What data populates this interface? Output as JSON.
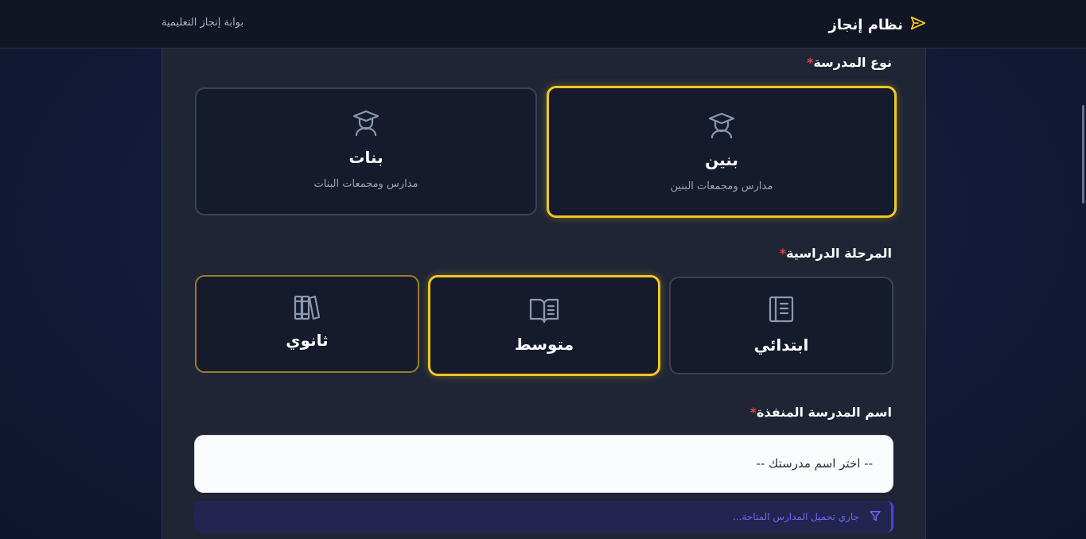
{
  "header": {
    "brand_title": "نظام إنجاز",
    "portal_name": "بوابة إنجاز التعليمية",
    "brand_color": "#f3c622"
  },
  "school_type": {
    "label": "نوع المدرسة",
    "required_mark": "*",
    "options": [
      {
        "title": "بنين",
        "subtitle": "مدارس ومجمعات البنين",
        "icon": "graduate-icon",
        "selected": true
      },
      {
        "title": "بنات",
        "subtitle": "مدارس ومجمعات البنات",
        "icon": "graduate-icon",
        "selected": false
      }
    ]
  },
  "stage": {
    "label": "المرحلة الدراسية",
    "required_mark": "*",
    "options": [
      {
        "title": "ابتدائي",
        "icon": "notebook-icon",
        "selected": false
      },
      {
        "title": "متوسط",
        "icon": "open-book-icon",
        "selected": true
      },
      {
        "title": "ثانوي",
        "icon": "books-icon",
        "selected": false
      }
    ]
  },
  "school_name": {
    "label": "اسم المدرسة المنفذة",
    "required_mark": "*",
    "placeholder": "-- اختر اسم مدرستك --"
  },
  "loading": {
    "message": "جاري تحميل المدارس المتاحة...",
    "icon": "filter-icon",
    "color": "#6b66f0"
  },
  "colors": {
    "accent": "#f3c622",
    "panel": "#1f2535",
    "card": "#151b2c",
    "required": "#e04444"
  }
}
